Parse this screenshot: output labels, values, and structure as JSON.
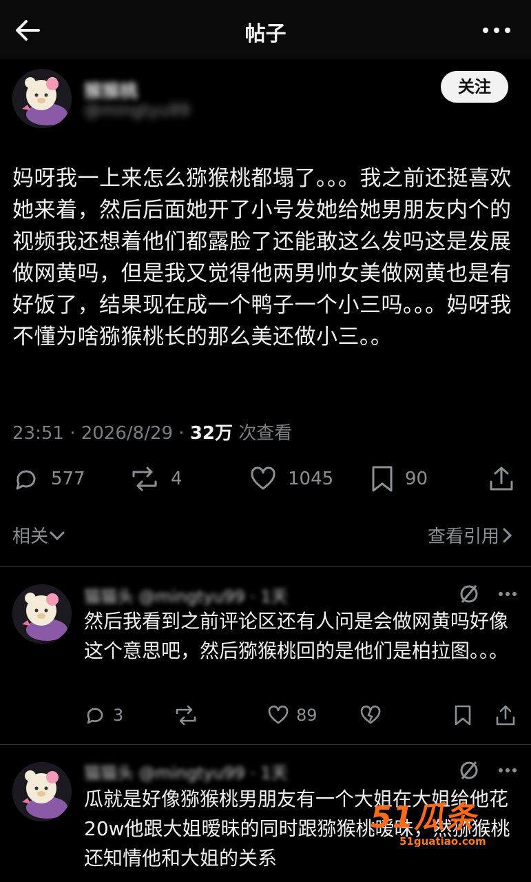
{
  "header": {
    "title": "帖子"
  },
  "post": {
    "follow_label": "关注",
    "text": "妈呀我一上来怎么猕猴桃都塌了。。。我之前还挺喜欢她来着，然后后面她开了小号发她给她男朋友内个的视频我还想着他们都露脸了还能敢这么发吗这是发展做网黄吗，但是我又觉得他两男帅女美做网黄也是有好饭了，结果现在成一个鸭子一个小三吗。。。妈呀我不懂为啥猕猴桃长的那么美还做小三。。",
    "time": "23:51 · 2026/8/29 · ",
    "views": "32万",
    "views_suffix": " 次查看",
    "replies": "577",
    "reposts": "4",
    "likes": "1045",
    "bookmarks": "90",
    "related_label": "相关",
    "quote_label": "查看引用"
  },
  "replies": [
    {
      "text": "然后我看到之前评论区还有人问是会做网黄吗好像这个意思吧，然后猕猴桃回的是他们是柏拉图。。。",
      "reply_count": "3",
      "like_count": "89"
    },
    {
      "text": "瓜就是好像猕猴桃男朋友有一个大姐在大姐给他花20w他跟大姐暧昧的同时跟猕猴桃暧昧，然猕猴桃还知情他和大姐的关系"
    }
  ],
  "watermark": {
    "brand": "51瓜条",
    "url": "51guatiao.com"
  },
  "colors": {
    "background": "#000000",
    "text": "#f0f0f0",
    "muted": "#8b9094",
    "watermark": "#ff6a1a"
  }
}
